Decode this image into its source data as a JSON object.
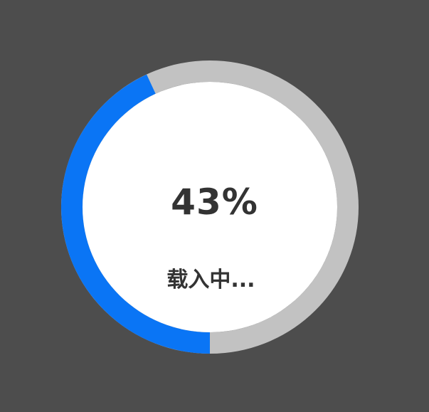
{
  "loader": {
    "progress": 0.43,
    "percent_text": "43%",
    "status_text": "载入中...",
    "colors": {
      "background": "#4d4d4d",
      "track": "#c2c2c2",
      "progress": "#0a75f5",
      "inner": "#ffffff",
      "text": "#333333"
    }
  }
}
